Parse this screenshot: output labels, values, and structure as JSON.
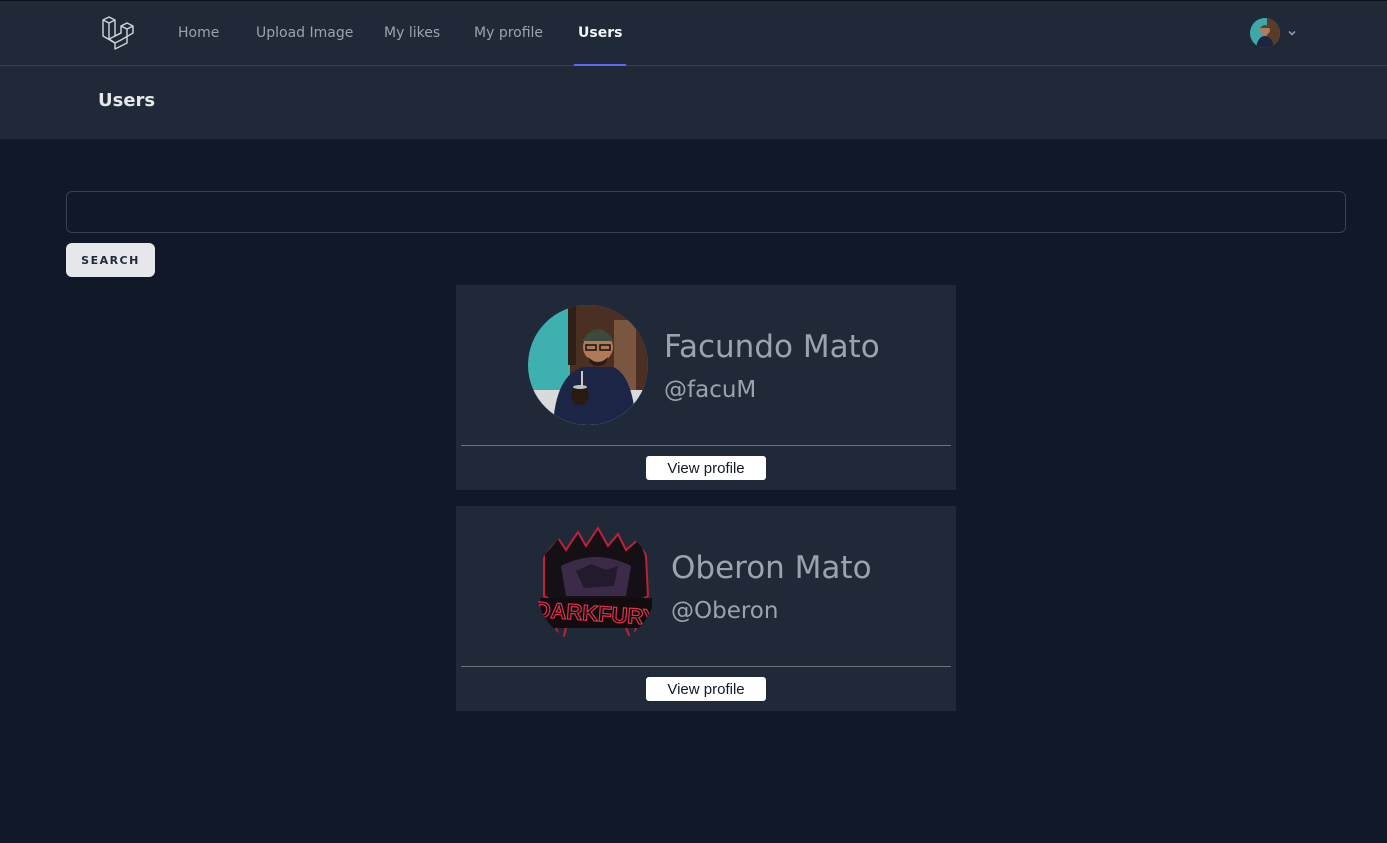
{
  "nav": {
    "items": [
      {
        "label": "Home"
      },
      {
        "label": "Upload Image"
      },
      {
        "label": "My likes"
      },
      {
        "label": "My profile"
      },
      {
        "label": "Users",
        "active": true
      }
    ],
    "icons": {
      "logo": "laravel-logo",
      "user_avatar": "avatar",
      "menu": "chevron-down-icon"
    }
  },
  "header": {
    "title": "Users"
  },
  "search": {
    "value": "",
    "placeholder": "",
    "button_label": "SEARCH"
  },
  "users": [
    {
      "name": "Facundo Mato",
      "username": "@facuM",
      "button_label": "View profile"
    },
    {
      "name": "Oberon Mato",
      "username": "@Oberon",
      "button_label": "View profile",
      "avatar_logo_text": "DARKFURY"
    }
  ],
  "colors": {
    "background": "#111827",
    "panel": "#1f2937",
    "accent": "#6366f1"
  }
}
